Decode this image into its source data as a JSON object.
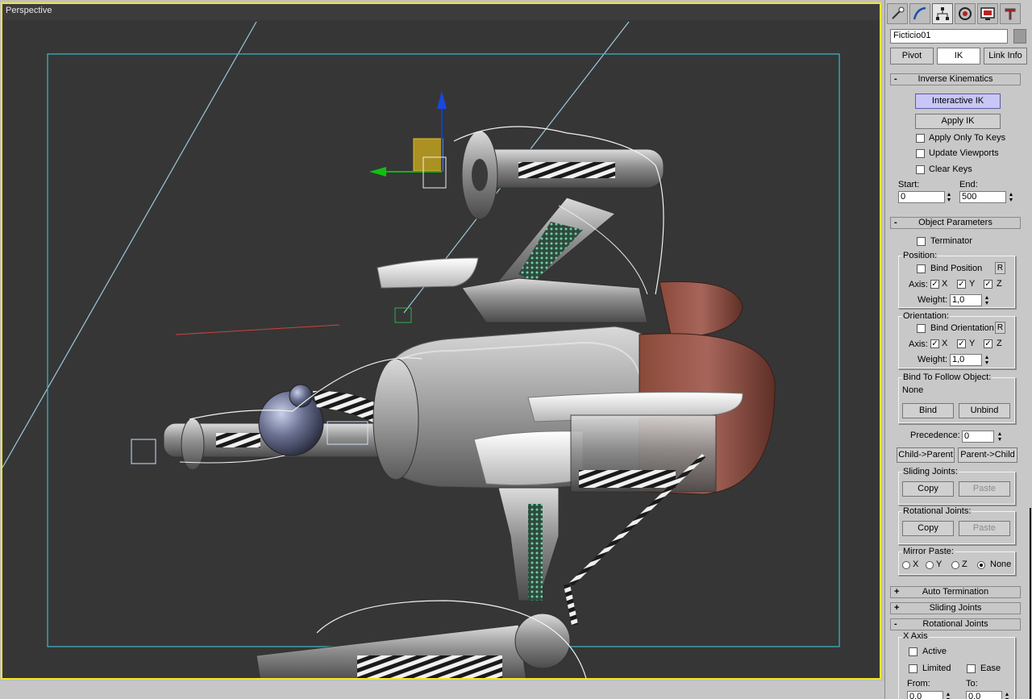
{
  "viewport": {
    "label": "Perspective"
  },
  "panel": {
    "tabs": [
      {
        "icon": "create-icon"
      },
      {
        "icon": "modify-icon"
      },
      {
        "icon": "hierarchy-icon"
      },
      {
        "icon": "motion-icon"
      },
      {
        "icon": "display-icon"
      },
      {
        "icon": "utilities-icon"
      }
    ],
    "object_name": "Ficticio01",
    "modes": {
      "pivot": "Pivot",
      "ik": "IK",
      "link_info": "Link Info"
    },
    "inverse_kinematics": {
      "title": "Inverse Kinematics",
      "sign": "-",
      "interactive_ik": "Interactive IK",
      "apply_ik": "Apply IK",
      "apply_only_keys": "Apply Only To Keys",
      "update_viewports": "Update Viewports",
      "clear_keys": "Clear Keys",
      "start_label": "Start:",
      "end_label": "End:",
      "start_value": "0",
      "end_value": "500"
    },
    "object_parameters": {
      "title": "Object Parameters",
      "sign": "-",
      "terminator": "Terminator",
      "position_label": "Position:",
      "bind_position": "Bind Position",
      "r": "R",
      "axis_label": "Axis:",
      "x": "X",
      "y": "Y",
      "z": "Z",
      "weight_label": "Weight:",
      "pos_weight": "1,0",
      "orientation_label": "Orientation:",
      "bind_orientation": "Bind Orientation",
      "ori_weight": "1,0",
      "bind_follow_label": "Bind To Follow Object:",
      "follow_object": "None",
      "bind": "Bind",
      "unbind": "Unbind",
      "precedence_label": "Precedence:",
      "precedence_value": "0",
      "child_parent": "Child->Parent",
      "parent_child": "Parent->Child",
      "sliding_joints_label": "Sliding Joints:",
      "rotational_joints_label": "Rotational Joints:",
      "copy": "Copy",
      "paste": "Paste",
      "mirror_paste_label": "Mirror Paste:",
      "mirror_x": "X",
      "mirror_y": "Y",
      "mirror_z": "Z",
      "mirror_none": "None"
    },
    "auto_termination": {
      "title": "Auto Termination",
      "sign": "+"
    },
    "sliding_joints": {
      "title": "Sliding Joints",
      "sign": "+"
    },
    "rotational_joints": {
      "title": "Rotational Joints",
      "sign": "-",
      "x_axis_label": "X Axis",
      "active": "Active",
      "limited": "Limited",
      "ease": "Ease",
      "from_label": "From:",
      "to_label": "To:",
      "from_value": "0,0",
      "to_value": "0,0"
    }
  },
  "colors": {
    "viewport_border": "#f2e62a",
    "viewport_bg": "#363636",
    "safe_frame": "#3fb8c8",
    "highlight_button": "#c8c6f4"
  }
}
